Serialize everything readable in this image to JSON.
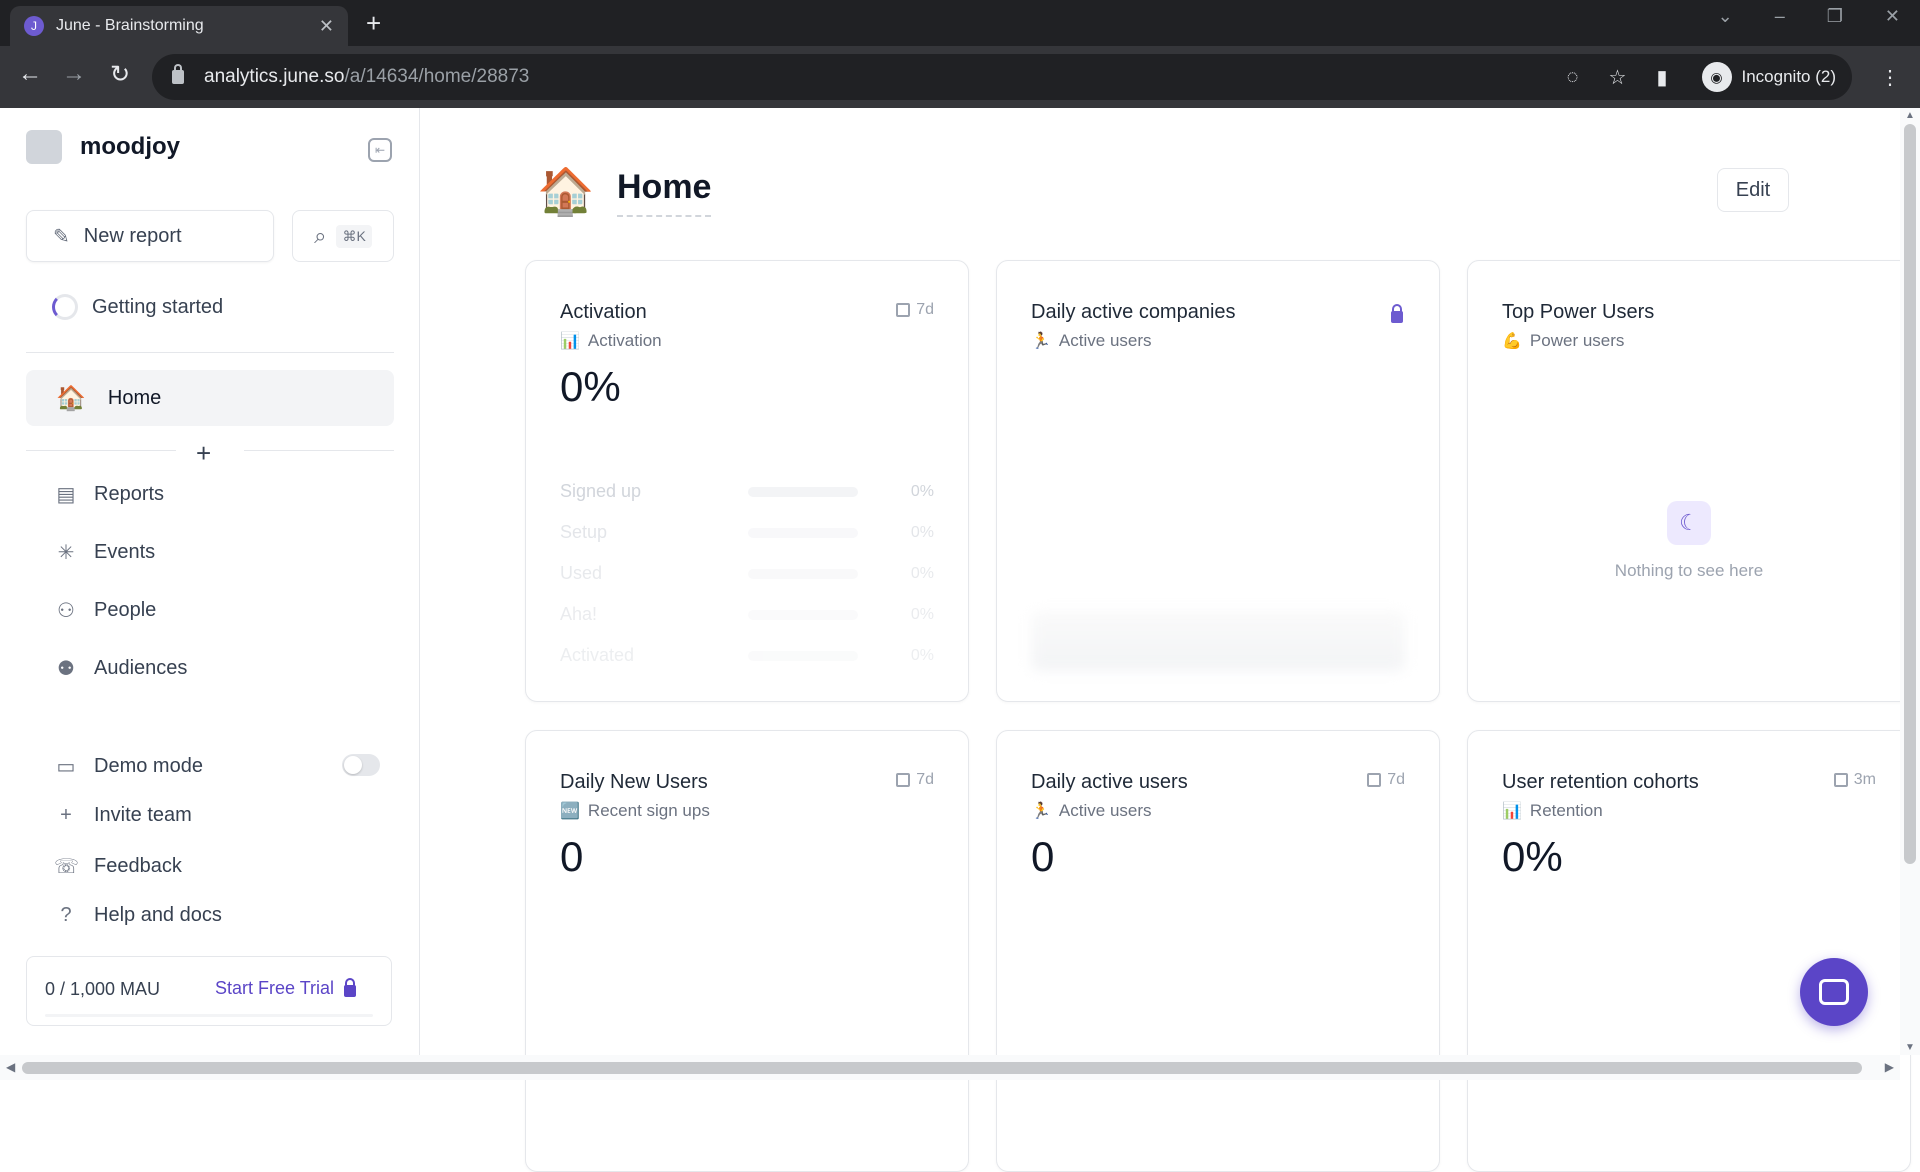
{
  "browser": {
    "tab_title": "June - Brainstorming",
    "tab_favicon": "J",
    "url_host": "analytics.june.so",
    "url_path": "/a/14634/home/28873",
    "incognito_label": "Incognito (2)"
  },
  "sidebar": {
    "workspace_name": "moodjoy",
    "new_report_label": "New report",
    "search_shortcut": "⌘K",
    "getting_started_label": "Getting started",
    "home_label": "Home",
    "nav": [
      {
        "label": "Reports",
        "icon": "reports-icon"
      },
      {
        "label": "Events",
        "icon": "events-icon"
      },
      {
        "label": "People",
        "icon": "people-icon"
      },
      {
        "label": "Audiences",
        "icon": "audiences-icon"
      }
    ],
    "bottom": [
      {
        "label": "Demo mode",
        "icon": "monitor-icon"
      },
      {
        "label": "Invite team",
        "icon": "plus-icon"
      },
      {
        "label": "Feedback",
        "icon": "feedback-icon"
      },
      {
        "label": "Help and docs",
        "icon": "help-icon"
      }
    ],
    "demo_mode_on": false,
    "mau_count": "0 / 1,000 MAU",
    "trial_label": "Start Free Trial"
  },
  "main": {
    "page_title": "Home",
    "edit_label": "Edit",
    "cards": [
      {
        "title": "Activation",
        "subtitle": "Activation",
        "period": "7d",
        "value": "0%",
        "funnel": [
          {
            "label": "Signed up",
            "value": "0%"
          },
          {
            "label": "Setup",
            "value": "0%"
          },
          {
            "label": "Used",
            "value": "0%"
          },
          {
            "label": "Aha!",
            "value": "0%"
          },
          {
            "label": "Activated",
            "value": "0%"
          }
        ]
      },
      {
        "title": "Daily active companies",
        "subtitle": "Active users"
      },
      {
        "title": "Top Power Users",
        "subtitle": "Power users",
        "empty_text": "Nothing to see here"
      },
      {
        "title": "Daily New Users",
        "subtitle": "Recent sign ups",
        "period": "7d",
        "value": "0"
      },
      {
        "title": "Daily active users",
        "subtitle": "Active users",
        "period": "7d",
        "value": "0"
      },
      {
        "title": "User retention cohorts",
        "subtitle": "Retention",
        "period": "3m",
        "value": "0%"
      }
    ]
  },
  "colors": {
    "accent": "#5b45c7",
    "chrome_dark": "#202124",
    "chrome_toolbar": "#35363a"
  }
}
